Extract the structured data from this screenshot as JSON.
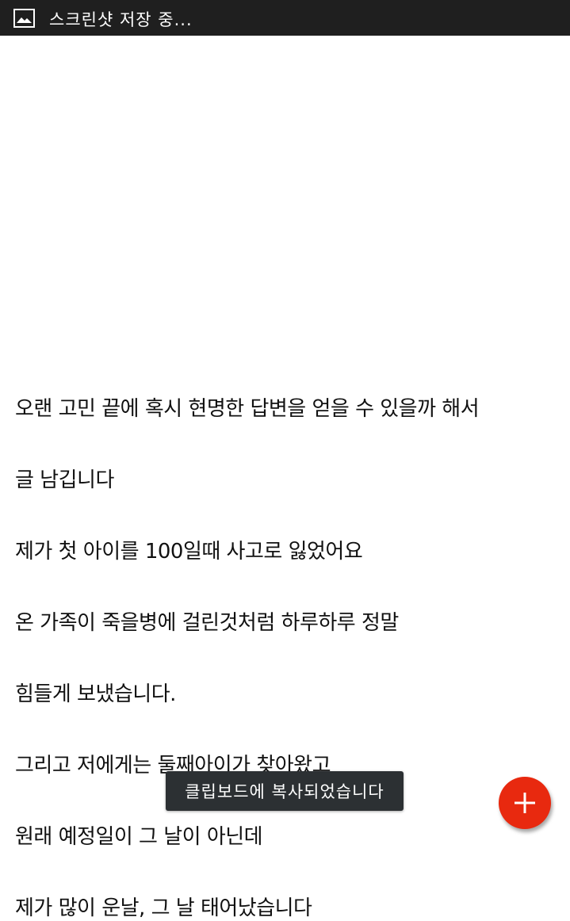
{
  "status_bar": {
    "icon": "image-icon",
    "text": "스크린샷 저장 중..."
  },
  "content": {
    "lines": [
      "오랜 고민 끝에 혹시 현명한 답변을 얻을 수 있을까 해서",
      "글 남깁니다",
      "제가 첫 아이를 100일때 사고로 잃었어요",
      "온 가족이 죽을병에 걸린것처럼 하루하루 정말",
      "힘들게 보냈습니다.",
      "그리고 저에게는 둘째아이가 찾아왔고",
      "원래 예정일이 그 날이 아닌데",
      "제가 많이 운날, 그 날 태어났습니다"
    ]
  },
  "toast": {
    "text": "클립보드에 복사되었습니다"
  },
  "fab": {
    "icon": "plus-icon",
    "color": "#e8290f"
  },
  "colors": {
    "status_bar_bg": "#1f1f1f",
    "toast_bg": "#2c3033",
    "text": "#111111"
  }
}
